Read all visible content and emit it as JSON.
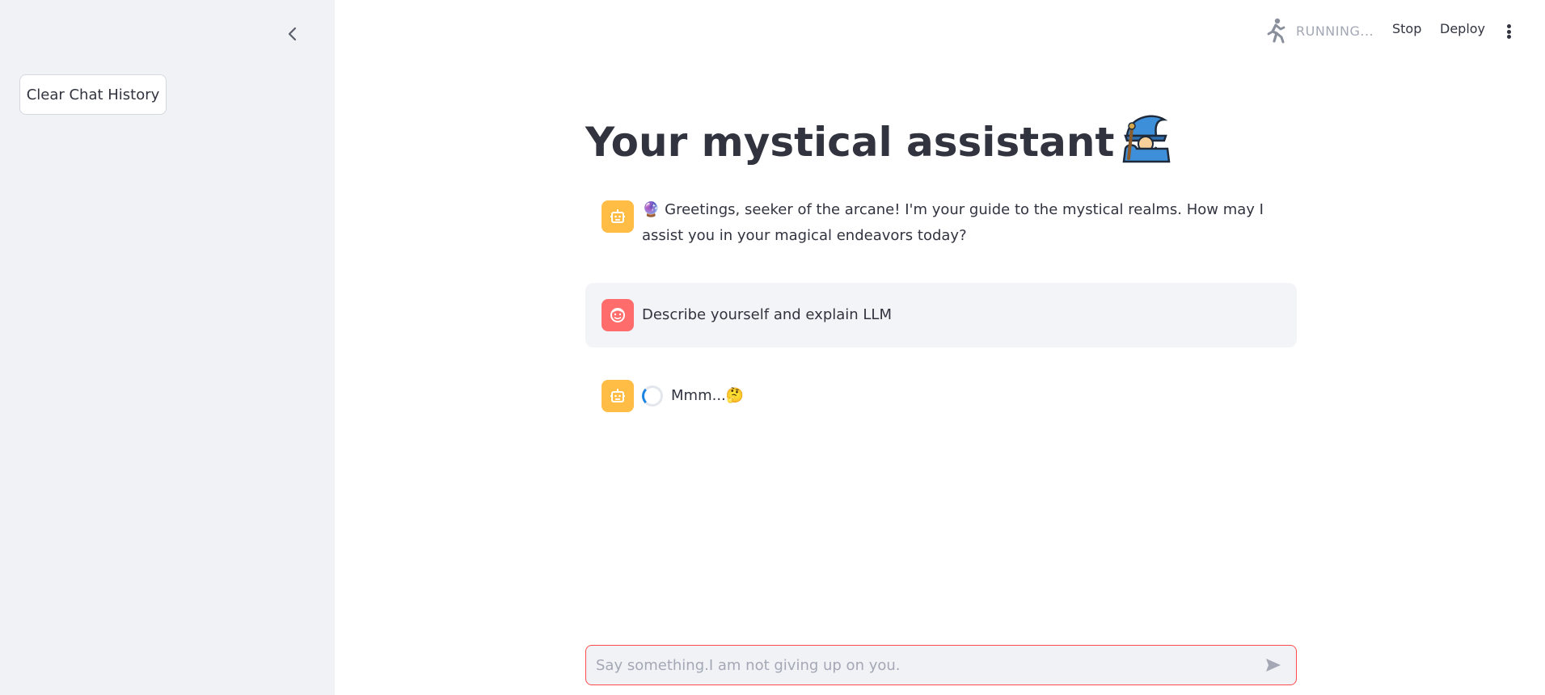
{
  "sidebar": {
    "collapse_icon": "chevron-left-icon",
    "clear_button_label": "Clear Chat History"
  },
  "header": {
    "status_text": "RUNNING...",
    "stop_label": "Stop",
    "deploy_label": "Deploy",
    "menu_icon": "vertical-dots-icon"
  },
  "main": {
    "title": "Your mystical assistant",
    "title_emoji": "🧙‍♂️"
  },
  "messages": [
    {
      "role": "assistant",
      "emoji": "🔮",
      "text": "Greetings, seeker of the arcane! I'm your guide to the mystical realms. How may I assist you in your magical endeavors today?"
    },
    {
      "role": "user",
      "text": "Describe yourself and explain LLM"
    },
    {
      "role": "assistant",
      "text": "Mmm...",
      "emoji": "🤔"
    }
  ],
  "chat_input": {
    "placeholder": "Say something.I am not giving up on you."
  },
  "colors": {
    "sidebar_bg": "#f0f2f6",
    "bot_avatar": "#ffbd45",
    "user_avatar": "#ff6c6c",
    "input_border": "#ff4b4b",
    "spinner": "#1c83e1"
  }
}
